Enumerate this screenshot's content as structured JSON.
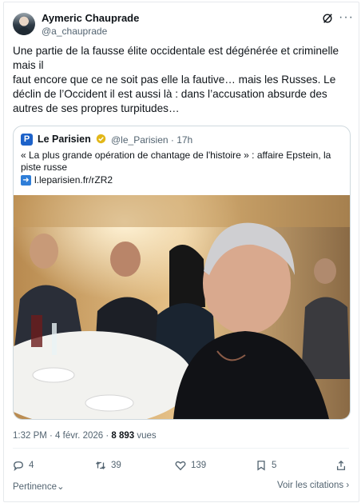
{
  "author": {
    "name": "Aymeric Chauprade",
    "handle": "@a_chauprade"
  },
  "icons": {
    "grok": "grok-icon",
    "more": "more-icon",
    "verified": "verified-badge-icon",
    "link": "arrow-right-icon"
  },
  "tweet": {
    "text": "Une partie de la fausse élite occidentale est dégénérée et criminelle mais il\nfaut encore que ce ne soit pas elle la fautive… mais les Russes. Le déclin de l’Occident il est aussi là : dans l’accusation absurde des autres de ses propres turpitudes…"
  },
  "quote": {
    "logo_letter": "P",
    "name": "Le Parisien",
    "handle_time": "@le_Parisien · 17h",
    "text": "« La plus grande opération de chantage de l'histoire » : affaire Epstein, la piste russe",
    "link": "l.leparisien.fr/rZR2"
  },
  "meta": {
    "time_date": "1:32 PM · 4 févr. 2026 · ",
    "views": "8 893",
    "views_label": " vues"
  },
  "actions": {
    "replies": "4",
    "reposts": "39",
    "likes": "139",
    "bookmarks": "5"
  },
  "footer": {
    "relevance": "Pertinence",
    "see_quotes": "Voir les citations"
  },
  "colors": {
    "accent_blue": "#1d62c9",
    "verified": "#e2b719",
    "muted": "#536471"
  }
}
